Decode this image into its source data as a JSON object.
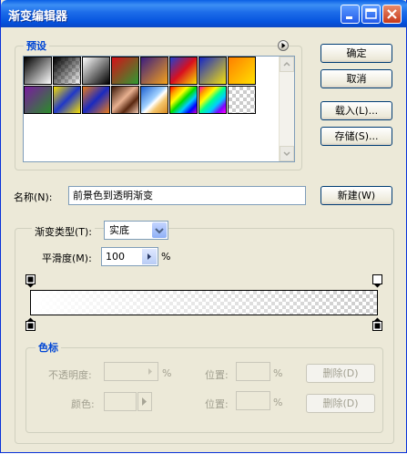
{
  "window": {
    "title": "渐变编辑器"
  },
  "buttons": {
    "ok": "确定",
    "cancel": "取消",
    "load": "载入(L)...",
    "save": "存储(S)...",
    "new": "新建(W)",
    "delete1": "删除(D)",
    "delete2": "删除(D)"
  },
  "presets": {
    "label": "预设"
  },
  "name": {
    "label": "名称(N):",
    "value": "前景色到透明渐变"
  },
  "gradient_type": {
    "label": "渐变类型(T):",
    "value": "实底"
  },
  "smoothness": {
    "label": "平滑度(M):",
    "value": "100",
    "unit": "%"
  },
  "stops": {
    "label": "色标",
    "opacity_label": "不透明度:",
    "opacity_unit": "%",
    "position_label1": "位置:",
    "position_unit1": "%",
    "color_label": "颜色:",
    "position_label2": "位置:",
    "position_unit2": "%"
  },
  "colors": {
    "title_bar": "#0a5fe5",
    "dialog_bg": "#ece9d8",
    "group_label": "#0046d5"
  }
}
